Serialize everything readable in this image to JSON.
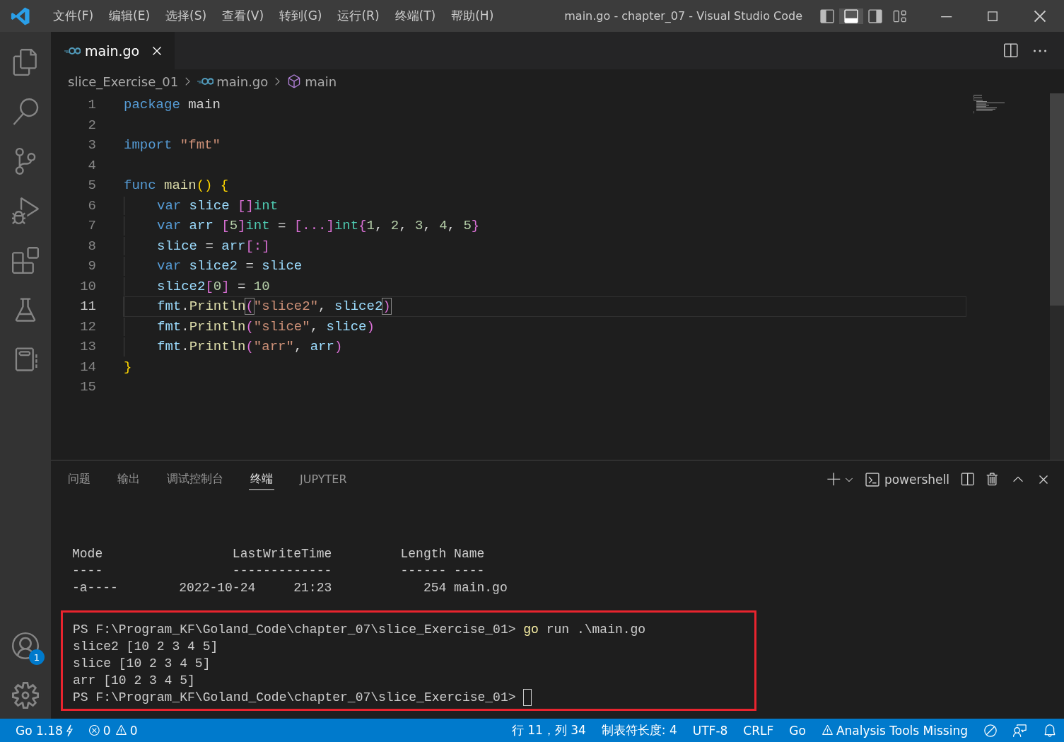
{
  "menu": [
    "文件(F)",
    "编辑(E)",
    "选择(S)",
    "查看(V)",
    "转到(G)",
    "运行(R)",
    "终端(T)",
    "帮助(H)"
  ],
  "window": {
    "title": "main.go - chapter_07 - Visual Studio Code"
  },
  "layout_toggles": [
    {
      "kind": "sidebar",
      "on": false
    },
    {
      "kind": "panel",
      "on": true
    },
    {
      "kind": "secondary",
      "on": false
    },
    {
      "kind": "custom",
      "on": false
    }
  ],
  "activity_bar": {
    "items": [
      {
        "kind": "explorer",
        "selected": false
      },
      {
        "kind": "search",
        "selected": false
      },
      {
        "kind": "scm",
        "selected": false
      },
      {
        "kind": "debug",
        "selected": false
      },
      {
        "kind": "extensions",
        "selected": false
      },
      {
        "kind": "testing",
        "selected": false
      },
      {
        "kind": "notebook",
        "selected": false
      }
    ],
    "account_badge": "1"
  },
  "tabs": [
    {
      "label": "main.go",
      "selected": true
    }
  ],
  "breadcrumbs": [
    {
      "kind": "folder",
      "label": "slice_Exercise_01"
    },
    {
      "kind": "file",
      "label": "main.go"
    },
    {
      "kind": "symbol",
      "label": "main"
    }
  ],
  "code": [
    {
      "number": "1",
      "selected": false,
      "indent": false,
      "tokens": [
        {
          "kind": "kw",
          "text": "package "
        },
        {
          "kind": "plain",
          "text": "main"
        }
      ]
    },
    {
      "number": "2",
      "selected": false,
      "indent": false
    },
    {
      "number": "3",
      "selected": false,
      "indent": false,
      "tokens": [
        {
          "kind": "kw",
          "text": "import "
        },
        {
          "kind": "str",
          "text": "\"fmt\""
        }
      ]
    },
    {
      "number": "4",
      "selected": false,
      "indent": false
    },
    {
      "number": "5",
      "selected": false,
      "indent": false,
      "tokens": [
        {
          "kind": "kw",
          "text": "func "
        },
        {
          "kind": "fn",
          "text": "main"
        },
        {
          "kind": "b1",
          "text": "() {"
        }
      ]
    },
    {
      "number": "6",
      "selected": false,
      "indent": true,
      "tokens": [
        {
          "kind": "kw",
          "text": "var "
        },
        {
          "kind": "var",
          "text": "slice "
        },
        {
          "kind": "b2",
          "text": "[]"
        },
        {
          "kind": "type",
          "text": "int"
        }
      ]
    },
    {
      "number": "7",
      "selected": false,
      "indent": true,
      "tokens": [
        {
          "kind": "kw",
          "text": "var "
        },
        {
          "kind": "var",
          "text": "arr "
        },
        {
          "kind": "b2",
          "text": "["
        },
        {
          "kind": "num",
          "text": "5"
        },
        {
          "kind": "b2",
          "text": "]"
        },
        {
          "kind": "type",
          "text": "int"
        },
        {
          "kind": "plain",
          "text": " = "
        },
        {
          "kind": "b2",
          "text": "[...]"
        },
        {
          "kind": "type",
          "text": "int"
        },
        {
          "kind": "b2",
          "text": "{"
        },
        {
          "kind": "num",
          "text": "1"
        },
        {
          "kind": "plain",
          "text": ", "
        },
        {
          "kind": "num",
          "text": "2"
        },
        {
          "kind": "plain",
          "text": ", "
        },
        {
          "kind": "num",
          "text": "3"
        },
        {
          "kind": "plain",
          "text": ", "
        },
        {
          "kind": "num",
          "text": "4"
        },
        {
          "kind": "plain",
          "text": ", "
        },
        {
          "kind": "num",
          "text": "5"
        },
        {
          "kind": "b2",
          "text": "}"
        }
      ]
    },
    {
      "number": "8",
      "selected": false,
      "indent": true,
      "tokens": [
        {
          "kind": "var",
          "text": "slice"
        },
        {
          "kind": "plain",
          "text": " = "
        },
        {
          "kind": "var",
          "text": "arr"
        },
        {
          "kind": "b2",
          "text": "[:]"
        }
      ]
    },
    {
      "number": "9",
      "selected": false,
      "indent": true,
      "tokens": [
        {
          "kind": "kw",
          "text": "var "
        },
        {
          "kind": "var",
          "text": "slice2"
        },
        {
          "kind": "plain",
          "text": " = "
        },
        {
          "kind": "var",
          "text": "slice"
        }
      ]
    },
    {
      "number": "10",
      "selected": false,
      "indent": true,
      "tokens": [
        {
          "kind": "var",
          "text": "slice2"
        },
        {
          "kind": "b2",
          "text": "["
        },
        {
          "kind": "num",
          "text": "0"
        },
        {
          "kind": "b2",
          "text": "]"
        },
        {
          "kind": "plain",
          "text": " = "
        },
        {
          "kind": "num",
          "text": "10"
        }
      ]
    },
    {
      "number": "11",
      "selected": true,
      "indent": true,
      "tokens": [
        {
          "kind": "var",
          "text": "fmt"
        },
        {
          "kind": "plain",
          "text": "."
        },
        {
          "kind": "fn",
          "text": "Println"
        },
        {
          "kind": "b2m",
          "text": "("
        },
        {
          "kind": "str",
          "text": "\"slice2\""
        },
        {
          "kind": "plain",
          "text": ", "
        },
        {
          "kind": "var",
          "text": "slice2"
        },
        {
          "kind": "b2m",
          "text": ")"
        }
      ]
    },
    {
      "number": "12",
      "selected": false,
      "indent": true,
      "tokens": [
        {
          "kind": "var",
          "text": "fmt"
        },
        {
          "kind": "plain",
          "text": "."
        },
        {
          "kind": "fn",
          "text": "Println"
        },
        {
          "kind": "b2",
          "text": "("
        },
        {
          "kind": "str",
          "text": "\"slice\""
        },
        {
          "kind": "plain",
          "text": ", "
        },
        {
          "kind": "var",
          "text": "slice"
        },
        {
          "kind": "b2",
          "text": ")"
        }
      ]
    },
    {
      "number": "13",
      "selected": false,
      "indent": true,
      "tokens": [
        {
          "kind": "var",
          "text": "fmt"
        },
        {
          "kind": "plain",
          "text": "."
        },
        {
          "kind": "fn",
          "text": "Println"
        },
        {
          "kind": "b2",
          "text": "("
        },
        {
          "kind": "str",
          "text": "\"arr\""
        },
        {
          "kind": "plain",
          "text": ", "
        },
        {
          "kind": "var",
          "text": "arr"
        },
        {
          "kind": "b2",
          "text": ")"
        }
      ]
    },
    {
      "number": "14",
      "selected": false,
      "indent": false,
      "tokens": [
        {
          "kind": "b1",
          "text": "}"
        }
      ]
    },
    {
      "number": "15",
      "selected": false,
      "indent": false
    }
  ],
  "panel": {
    "tabs": [
      {
        "label": "问题",
        "selected": false
      },
      {
        "label": "输出",
        "selected": false
      },
      {
        "label": "调试控制台",
        "selected": false
      },
      {
        "label": "终端",
        "selected": true
      },
      {
        "label": "JUPYTER",
        "selected": false
      }
    ],
    "shell": "powershell"
  },
  "terminal": {
    "lines": [
      "Mode                 LastWriteTime         Length Name",
      "----                 -------------         ------ ----",
      "-a----        2022-10-24     21:23            254 main.go"
    ],
    "highlighted": [
      [
        {
          "kind": "plain",
          "text": "PS F:\\Program_KF\\Goland_Code\\chapter_07\\slice_Exercise_01> "
        },
        {
          "kind": "cmd",
          "text": "go"
        },
        {
          "kind": "plain",
          "text": " run .\\main.go"
        }
      ],
      [
        {
          "kind": "plain",
          "text": "slice2 [10 2 3 4 5]"
        }
      ],
      [
        {
          "kind": "plain",
          "text": "slice [10 2 3 4 5]"
        }
      ],
      [
        {
          "kind": "plain",
          "text": "arr [10 2 3 4 5]"
        }
      ],
      [
        {
          "kind": "plain",
          "text": "PS F:\\Program_KF\\Goland_Code\\chapter_07\\slice_Exercise_01> "
        },
        {
          "kind": "cursor"
        }
      ]
    ]
  },
  "status_bar": {
    "left": [
      {
        "kind": "go",
        "text": "Go 1.18"
      },
      {
        "kind": "errors",
        "text": "0"
      },
      {
        "kind": "warnings",
        "text": "0"
      }
    ],
    "right": [
      {
        "kind": "text",
        "text": "行 11，列 34"
      },
      {
        "kind": "text",
        "text": "制表符长度: 4"
      },
      {
        "kind": "text",
        "text": "UTF-8"
      },
      {
        "kind": "text",
        "text": "CRLF"
      },
      {
        "kind": "text",
        "text": "Go"
      },
      {
        "kind": "warning",
        "text": "Analysis Tools Missing"
      }
    ]
  }
}
